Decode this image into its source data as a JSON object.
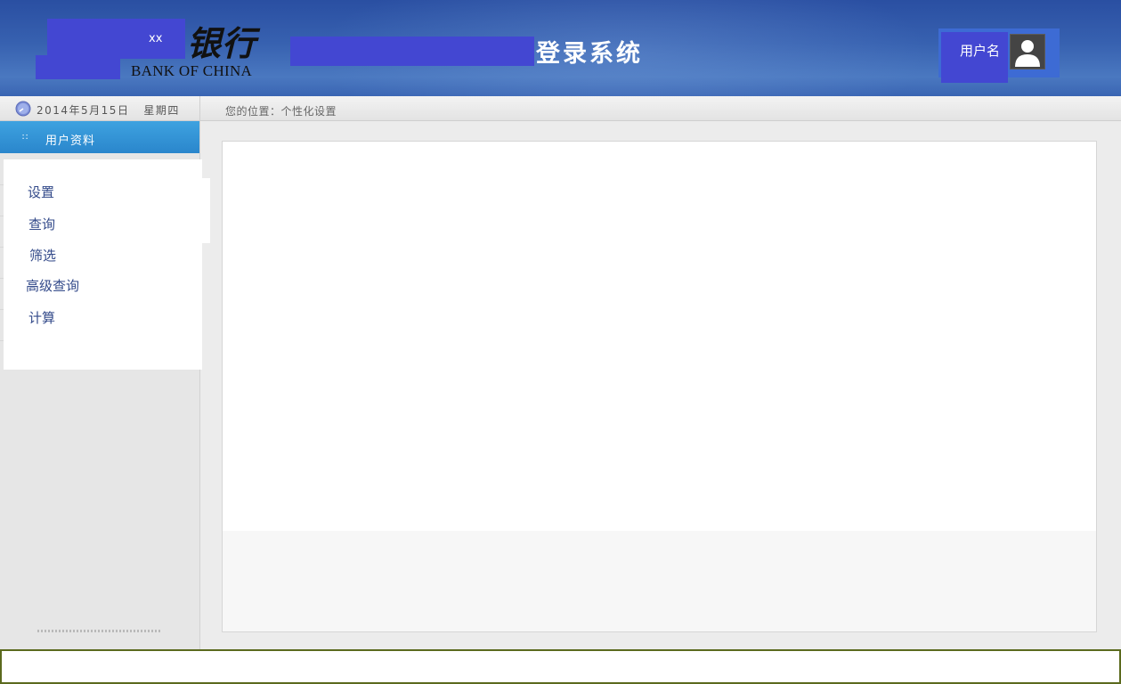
{
  "header": {
    "logo_masked_text": "xx",
    "logo_chinese": "银行",
    "logo_english": "BANK OF CHINA",
    "title_suffix": "登录系统",
    "user_label": "用户名",
    "avatar_icon": "user-avatar-icon"
  },
  "subbar": {
    "date": "2014年5月15日",
    "weekday": "星期四",
    "location": "您的位置：个性化设置"
  },
  "sidebar": {
    "header_label": "用户资料",
    "items": [
      {
        "label": "设置"
      },
      {
        "label": "查询"
      },
      {
        "label": "筛选"
      },
      {
        "label": "高级查询"
      },
      {
        "label": "计算"
      }
    ]
  },
  "colors": {
    "header_blue": "#3761b0",
    "redaction_blue": "#4347d2",
    "sidebar_header_blue": "#2a86cc",
    "menu_text": "#334a8a"
  }
}
